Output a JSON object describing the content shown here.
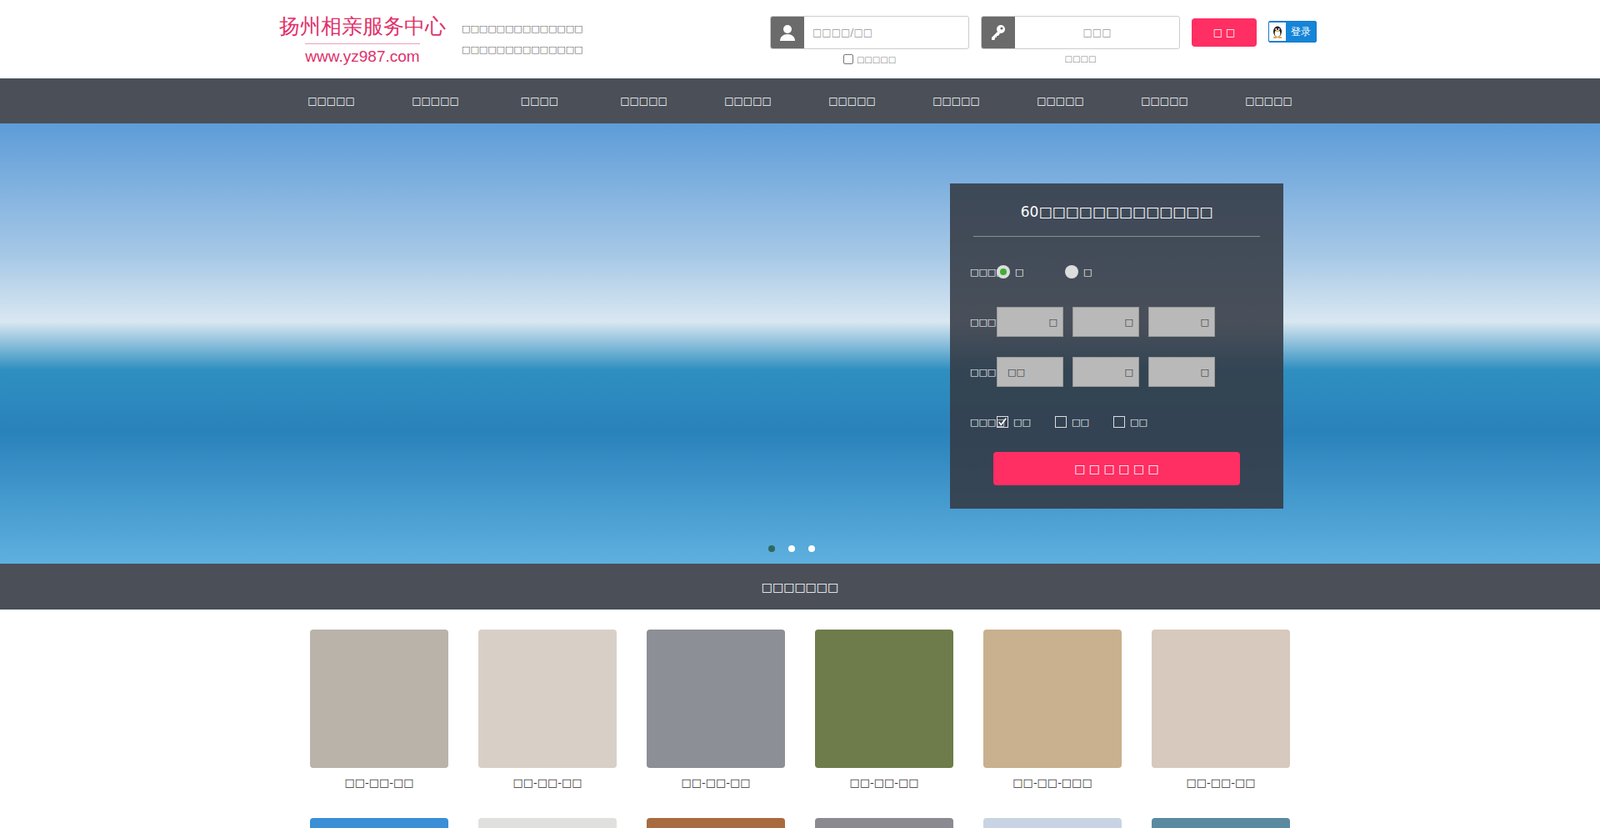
{
  "header": {
    "logo_title": "扬州相亲服务中心",
    "logo_url": "www.yz987.com",
    "slogans": [
      "□□□□□□□□□□□□□□",
      "□□□□□□□□□□□□□□"
    ],
    "username": {
      "placeholder": "□□□□/□□"
    },
    "remember": {
      "label": "□□□□□",
      "checked": false
    },
    "password": {
      "placeholder": "□□□"
    },
    "forgot": "□□□□",
    "submit": "□ □",
    "qq_login": "登录"
  },
  "nav": [
    "□□□□□",
    "□□□□□",
    "□□□□",
    "□□□□□",
    "□□□□□",
    "□□□□□",
    "□□□□□",
    "□□□□□",
    "□□□□□",
    "□□□□□"
  ],
  "banner": {
    "dots": [
      {
        "selected": true
      },
      {
        "selected": false
      },
      {
        "selected": false
      }
    ]
  },
  "search_form": {
    "title": "60□□□□□□□□□□□□□",
    "gender": {
      "label": "□□□□",
      "options": [
        {
          "label": "□",
          "selected": true
        },
        {
          "label": "□",
          "selected": false
        }
      ]
    },
    "age": {
      "label": "□□□□",
      "selects": [
        {
          "value": "",
          "arrow": "□"
        },
        {
          "value": "",
          "arrow": "□"
        },
        {
          "value": "",
          "arrow": "□"
        }
      ]
    },
    "region": {
      "label": "□□□□",
      "selects": [
        {
          "value": "□□",
          "arrow": ""
        },
        {
          "value": "",
          "arrow": "□"
        },
        {
          "value": "",
          "arrow": "□"
        }
      ]
    },
    "photo": {
      "label": "□□□□",
      "options": [
        {
          "label": "□□",
          "checked": true
        },
        {
          "label": "□□",
          "checked": false
        },
        {
          "label": "□□",
          "checked": false
        }
      ]
    },
    "button": "□ □ □ □ □ □"
  },
  "section": {
    "title": "□□□□□□□"
  },
  "profiles": [
    {
      "caption": "□□-□□-□□"
    },
    {
      "caption": "□□-□□-□□"
    },
    {
      "caption": "□□-□□-□□"
    },
    {
      "caption": "□□-□□-□□"
    },
    {
      "caption": "□□-□□-□□□"
    },
    {
      "caption": "□□-□□-□□"
    }
  ]
}
